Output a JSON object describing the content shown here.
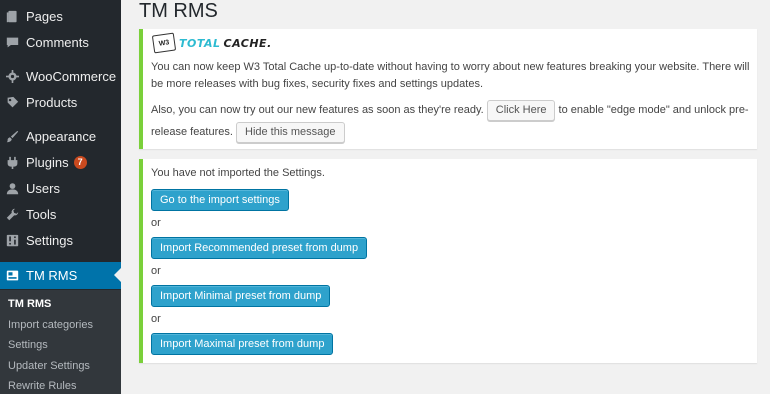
{
  "sidebar": {
    "items": [
      {
        "label": "Pages",
        "icon": "pages-icon"
      },
      {
        "label": "Comments",
        "icon": "comments-icon"
      },
      {
        "label": "WooCommerce",
        "icon": "woocommerce-icon"
      },
      {
        "label": "Products",
        "icon": "products-icon"
      },
      {
        "label": "Appearance",
        "icon": "appearance-icon"
      },
      {
        "label": "Plugins",
        "icon": "plugins-icon",
        "badge": "7"
      },
      {
        "label": "Users",
        "icon": "users-icon"
      },
      {
        "label": "Tools",
        "icon": "tools-icon"
      },
      {
        "label": "Settings",
        "icon": "settings-icon"
      },
      {
        "label": "TM RMS",
        "icon": "tmrms-icon",
        "active": true
      }
    ],
    "submenu": [
      {
        "label": "TM RMS",
        "current": true
      },
      {
        "label": "Import categories"
      },
      {
        "label": "Settings"
      },
      {
        "label": "Updater Settings"
      },
      {
        "label": "Rewrite Rules"
      }
    ]
  },
  "page": {
    "title": "TM RMS"
  },
  "notice_w3tc": {
    "logo_badge": "W3",
    "logo_total": "TOTAL",
    "logo_cache": "CACHE.",
    "paragraph1": "You can now keep W3 Total Cache up-to-date without having to worry about new features breaking your website. There will be more releases with bug fixes, security fixes and settings updates.",
    "paragraph2_before": "Also, you can now try out our new features as soon as they're ready.",
    "click_here_label": "Click Here",
    "paragraph2_after": "to enable \"edge mode\" and unlock pre-release features.",
    "hide_label": "Hide this message"
  },
  "notice_import": {
    "message": "You have not imported the Settings.",
    "go_import_label": "Go to the import settings",
    "or1": "or",
    "recommended_label": "Import Recommended preset from dump",
    "or2": "or",
    "minimal_label": "Import Minimal preset from dump",
    "or3": "or",
    "maximal_label": "Import Maximal preset from dump"
  },
  "colors": {
    "sidebar_bg": "#23282d",
    "active_bg": "#0073aa",
    "notice_border": "#7ad03a",
    "primary_button": "#2ea2cc",
    "badge": "#ca4a1f"
  }
}
